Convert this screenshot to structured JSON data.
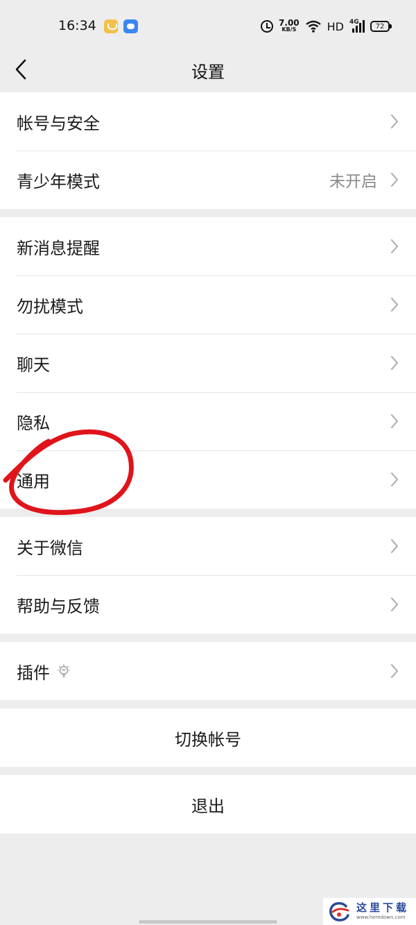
{
  "status_bar": {
    "time": "16:34",
    "net_speed_value": "7.00",
    "net_speed_unit": "KB/S",
    "hd_label": "HD",
    "network_type": "4G",
    "battery_level": "72",
    "icons": [
      "app-notification-icon-yellow",
      "app-notification-icon-blue",
      "alarm-icon",
      "wifi-icon",
      "signal-icon",
      "battery-icon"
    ]
  },
  "nav": {
    "back_icon": "chevron-left-icon",
    "title": "设置"
  },
  "groups": [
    {
      "items": [
        {
          "label": "帐号与安全"
        },
        {
          "label": "青少年模式",
          "value": "未开启"
        }
      ]
    },
    {
      "items": [
        {
          "label": "新消息提醒"
        },
        {
          "label": "勿扰模式"
        },
        {
          "label": "聊天"
        },
        {
          "label": "隐私"
        },
        {
          "label": "通用"
        }
      ]
    },
    {
      "items": [
        {
          "label": "关于微信"
        },
        {
          "label": "帮助与反馈"
        }
      ]
    },
    {
      "items": [
        {
          "label": "插件",
          "icon": "lightbulb-icon"
        }
      ]
    }
  ],
  "actions": {
    "switch_account": "切换帐号",
    "logout": "退出"
  },
  "annotation": {
    "color": "#e0141b",
    "target": "通用"
  },
  "watermark": {
    "title": "这里下载",
    "url": "www.heredown.com"
  },
  "colors": {
    "page_background": "#ededed",
    "card_background": "#ffffff",
    "secondary_text": "#8a8a8a",
    "watermark_blue": "#2a4a9a",
    "watermark_red": "#d8322c"
  }
}
